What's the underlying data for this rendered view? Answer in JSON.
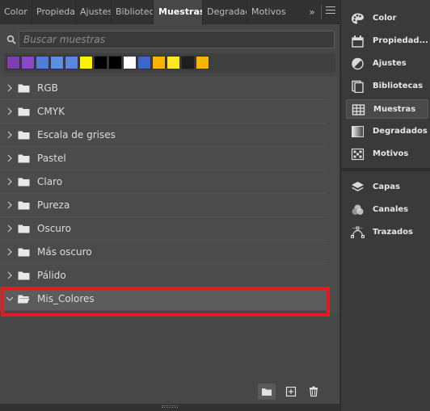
{
  "tabs": [
    {
      "label": "Color",
      "active": false
    },
    {
      "label": "Propiedades",
      "active": false
    },
    {
      "label": "Ajustes",
      "active": false
    },
    {
      "label": "Bibliotecas",
      "active": false
    },
    {
      "label": "Muestras",
      "active": true
    },
    {
      "label": "Degradados",
      "active": false
    },
    {
      "label": "Motivos",
      "active": false
    }
  ],
  "tab_overflow_icon": "double-chevron-right-icon",
  "panel_menu_icon": "hamburger-menu-icon",
  "search": {
    "placeholder": "Buscar muestras",
    "value": ""
  },
  "recent_swatches": [
    "#7e3fb0",
    "#8a4ac4",
    "#4f7fd6",
    "#5b8fe0",
    "#5a86dc",
    "#fff200",
    "#000000",
    "#000000",
    "#ffffff",
    "#3c66cc",
    "#f7b500",
    "#ffe81f",
    "#1e1e1e",
    "#f5b600"
  ],
  "swatch_groups": [
    {
      "label": "RGB",
      "expanded": false
    },
    {
      "label": "CMYK",
      "expanded": false
    },
    {
      "label": "Escala de grises",
      "expanded": false
    },
    {
      "label": "Pastel",
      "expanded": false
    },
    {
      "label": "Claro",
      "expanded": false
    },
    {
      "label": "Pureza",
      "expanded": false
    },
    {
      "label": "Oscuro",
      "expanded": false
    },
    {
      "label": "Más oscuro",
      "expanded": false
    },
    {
      "label": "Pálido",
      "expanded": false
    },
    {
      "label": "Mis_Colores",
      "expanded": true,
      "selected": true
    }
  ],
  "bottom_toolbar": {
    "buttons": [
      "new-group-folder-icon",
      "new-swatch-plus-icon",
      "trash-icon"
    ]
  },
  "right_panel": {
    "group1": [
      {
        "label": "Color",
        "icon": "palette-icon",
        "active": false
      },
      {
        "label": "Propiedad...",
        "icon": "properties-icon",
        "active": false
      },
      {
        "label": "Ajustes",
        "icon": "adjustments-icon",
        "active": false
      },
      {
        "label": "Bibliotecas",
        "icon": "libraries-icon",
        "active": false
      },
      {
        "label": "Muestras",
        "icon": "swatches-grid-icon",
        "active": true
      },
      {
        "label": "Degradados",
        "icon": "gradient-icon",
        "active": false
      },
      {
        "label": "Motivos",
        "icon": "patterns-icon",
        "active": false
      }
    ],
    "group2": [
      {
        "label": "Capas",
        "icon": "layers-icon",
        "active": false
      },
      {
        "label": "Canales",
        "icon": "channels-icon",
        "active": false
      },
      {
        "label": "Trazados",
        "icon": "paths-icon",
        "active": false
      }
    ]
  },
  "colors": {
    "panel_bg": "#474747",
    "row_bg": "#4b4b4b",
    "selected_row_bg": "#5c5c5c",
    "highlight_border": "#e21a22",
    "text": "#dcdcdc"
  }
}
